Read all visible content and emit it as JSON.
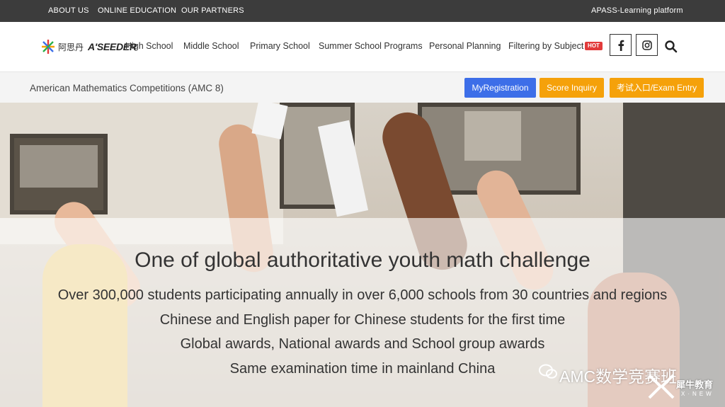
{
  "topbar": {
    "links": [
      "ABOUT US",
      "ONLINE EDUCATION",
      "OUR PARTNERS"
    ],
    "platform": "APASS-Learning platform"
  },
  "nav": {
    "logo_cn": "阿思丹",
    "logo_en": "A'SEEDER",
    "items": [
      "High School",
      "Middle School",
      "Primary School",
      "Summer School Programs",
      "Personal Planning",
      "Filtering by Subject"
    ],
    "hot_badge": "HOT",
    "social_icons": [
      "facebook-icon",
      "instagram-icon"
    ],
    "search_icon": "search-icon"
  },
  "subbar": {
    "title": "American Mathematics Competitions (AMC 8)",
    "buttons": [
      {
        "label": "MyRegistration",
        "color": "#3d6ee8"
      },
      {
        "label": "Score Inquiry",
        "color": "#f5a10a"
      },
      {
        "label": "考试入口/Exam Entry",
        "color": "#f5a10a"
      }
    ]
  },
  "hero": {
    "headline": "One of global authoritative youth math challenge",
    "lines": [
      "Over 300,000 students participating annually in over 6,000 schools from 30 countries and regions",
      "Chinese and English paper for Chinese students for the first time",
      "Global awards, National awards and School group awards",
      "Same examination time in mainland China"
    ]
  },
  "watermark": {
    "text": "AMC数学竞赛班",
    "brand": "犀牛教育",
    "brand_sub": "X·NEW"
  },
  "colors": {
    "topbar_bg": "#3c3c3c",
    "hot": "#e23b3b",
    "primary_blue": "#3d6ee8",
    "accent_orange": "#f5a10a"
  }
}
